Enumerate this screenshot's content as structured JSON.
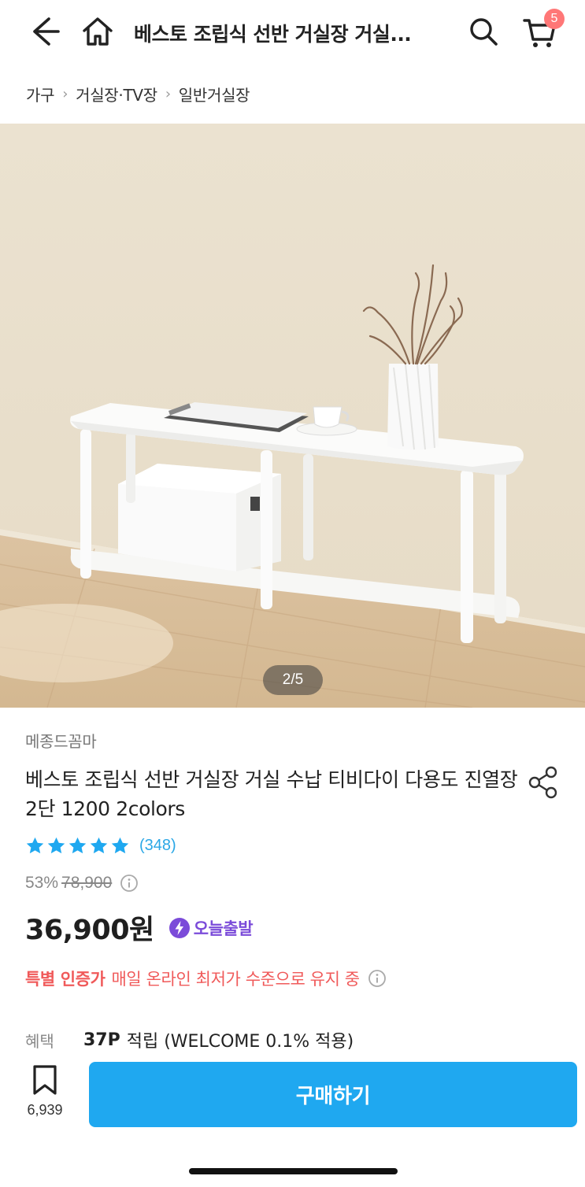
{
  "header": {
    "title": "베스토 조립식 선반 거실장 거실...",
    "cart_count": "5",
    "icons": [
      "back-arrow-icon",
      "home-icon",
      "search-icon",
      "cart-icon"
    ]
  },
  "breadcrumb": [
    "가구",
    "거실장·TV장",
    "일반거실장"
  ],
  "gallery": {
    "page_indicator": "2/5",
    "current": 2,
    "total": 5
  },
  "product": {
    "brand": "메종드꼼마",
    "name": "베스토 조립식 선반 거실장 거실 수납 티비다이 다용도 진열장 2단 1200 2colors",
    "rating_stars": 5,
    "review_count": "(348)",
    "discount": "53%",
    "original_price": "78,900",
    "price": "36,900원",
    "today_ship_label": "오늘출발",
    "special_label": "특별 인증가",
    "special_text": "매일 온라인 최저가 수준으로 유지 중",
    "benefit_label": "혜택",
    "benefit_points": "37P",
    "benefit_text": "적립 (WELCOME 0.1% 적용)"
  },
  "bottom_bar": {
    "bookmark_count": "6,939",
    "buy_label": "구매하기"
  },
  "colors": {
    "accent": "#1fa8f0",
    "star": "#1fa8f0",
    "special": "#f05a5a",
    "today_ship": "#7b4bd9",
    "badge": "#ff7777"
  }
}
